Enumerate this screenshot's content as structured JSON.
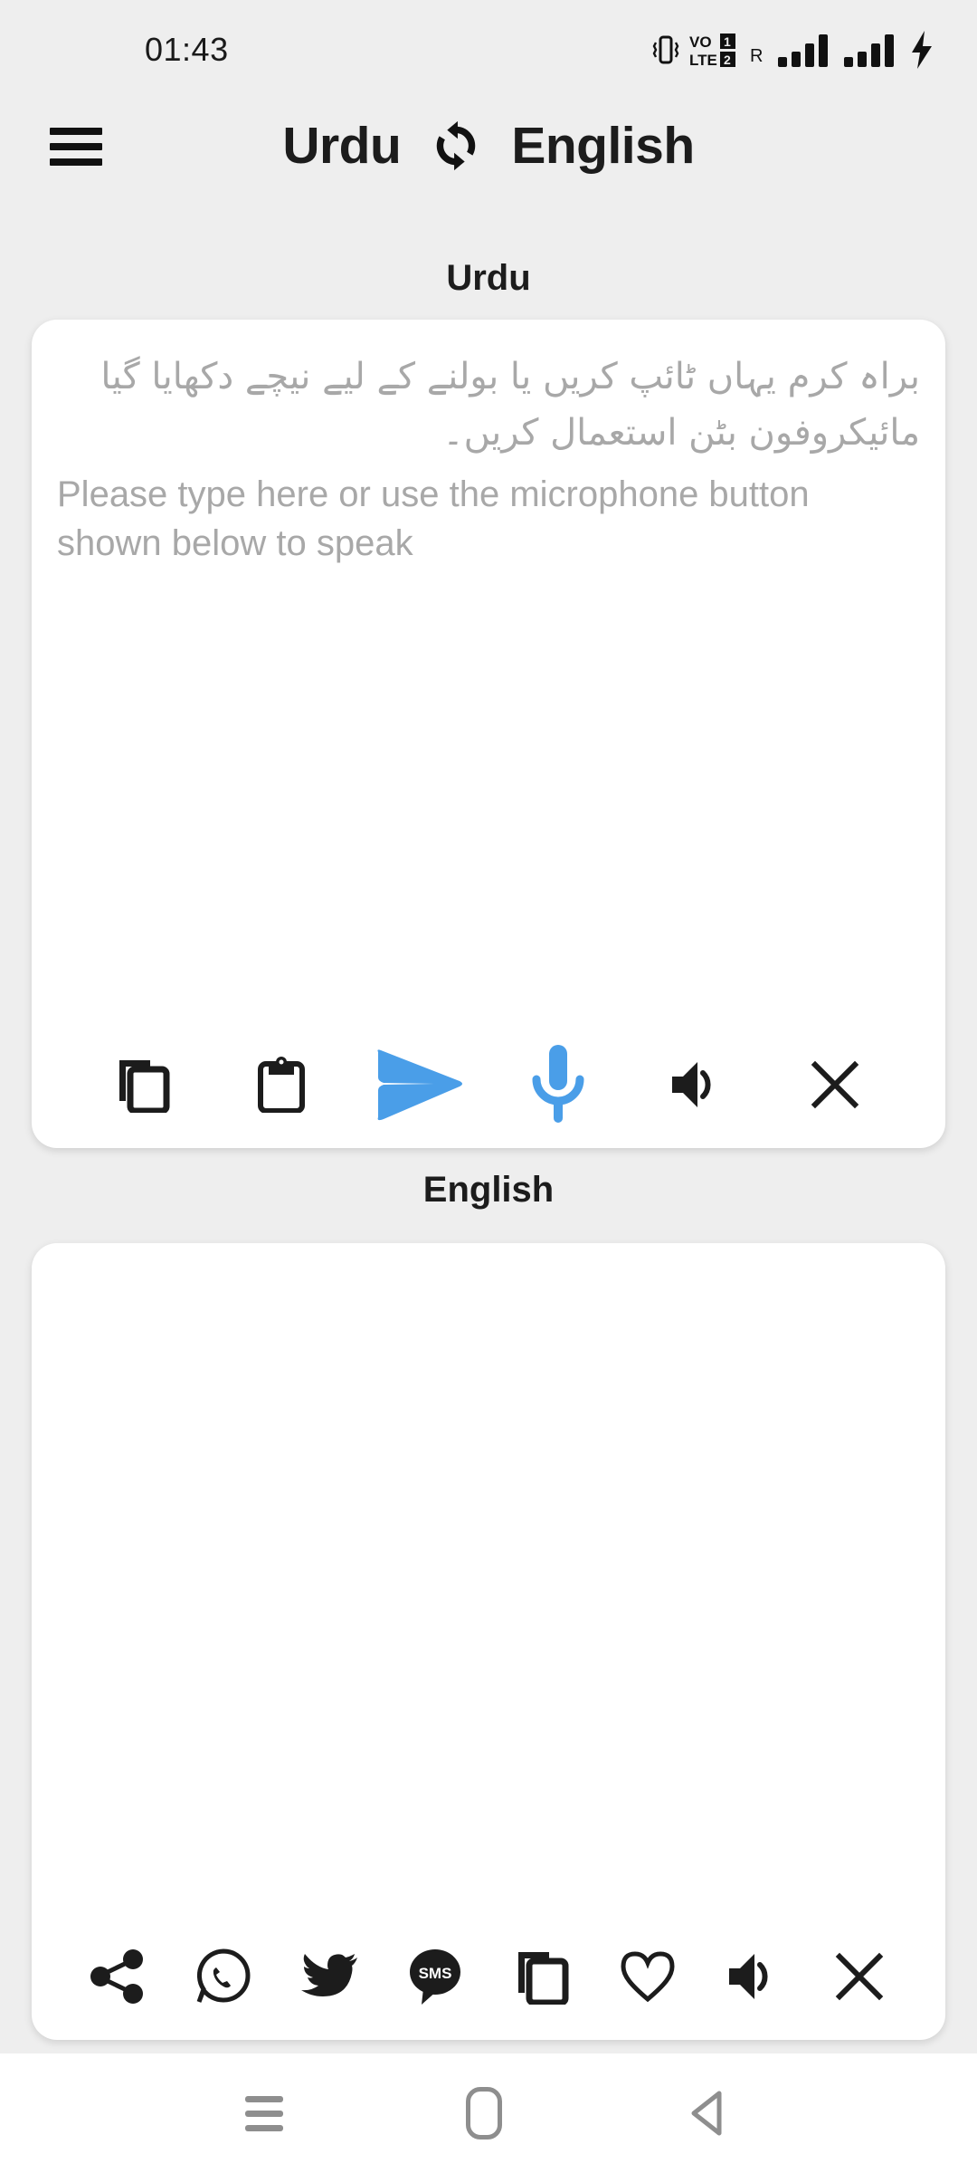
{
  "status_bar": {
    "time": "01:43",
    "icons": [
      "vibrate-icon",
      "volte-icon",
      "sim1-label",
      "sim2-label",
      "roaming-label",
      "signal-bars-1",
      "signal-bars-2",
      "charging-bolt-icon"
    ],
    "roaming_label": "R",
    "volte_text_top": "VO",
    "volte_text_bottom": "LTE",
    "sim_1": "1",
    "sim_2": "2"
  },
  "header": {
    "menu_icon": "hamburger-menu-icon",
    "source_language": "Urdu",
    "swap_icon": "swap-languages-icon",
    "target_language": "English"
  },
  "source_panel": {
    "label": "Urdu",
    "placeholder_native": "براہ کرم یہاں ٹائپ کریں یا بولنے کے لیے نیچے دکھایا گیا مائیکروفون بٹن استعمال کریں۔",
    "placeholder_english": "Please type here or use the microphone button shown below to speak",
    "value": "",
    "toolbar": [
      {
        "name": "copy-button",
        "icon": "copy-icon",
        "color": "#1c1c1c"
      },
      {
        "name": "paste-button",
        "icon": "clipboard-icon",
        "color": "#1c1c1c"
      },
      {
        "name": "translate-button",
        "icon": "send-arrow-icon",
        "color": "#4a9ee8"
      },
      {
        "name": "microphone-button",
        "icon": "microphone-icon",
        "color": "#4a9ee8"
      },
      {
        "name": "speak-button",
        "icon": "speaker-icon",
        "color": "#1c1c1c"
      },
      {
        "name": "clear-button",
        "icon": "close-x-icon",
        "color": "#1c1c1c"
      }
    ]
  },
  "target_panel": {
    "label": "English",
    "value": "",
    "toolbar": [
      {
        "name": "share-button",
        "icon": "share-icon",
        "color": "#1c1c1c"
      },
      {
        "name": "whatsapp-button",
        "icon": "whatsapp-icon",
        "color": "#1c1c1c"
      },
      {
        "name": "twitter-button",
        "icon": "twitter-icon",
        "color": "#1c1c1c"
      },
      {
        "name": "sms-button",
        "icon": "sms-icon",
        "label": "SMS",
        "color": "#1c1c1c"
      },
      {
        "name": "copy-button",
        "icon": "copy-icon",
        "color": "#1c1c1c"
      },
      {
        "name": "favorite-button",
        "icon": "heart-icon",
        "color": "#1c1c1c"
      },
      {
        "name": "speak-button",
        "icon": "speaker-icon",
        "color": "#1c1c1c"
      },
      {
        "name": "clear-button",
        "icon": "close-x-icon",
        "color": "#1c1c1c"
      }
    ]
  },
  "nav_bar": {
    "recents": "recents-icon",
    "home": "home-icon",
    "back": "back-icon"
  },
  "colors": {
    "page_background": "#eeeeee",
    "card_background": "#ffffff",
    "accent_blue": "#4a9ee8",
    "icon_dark": "#1c1c1c",
    "placeholder_gray": "#a8a8a8",
    "nav_gray": "#8e8e8e"
  }
}
